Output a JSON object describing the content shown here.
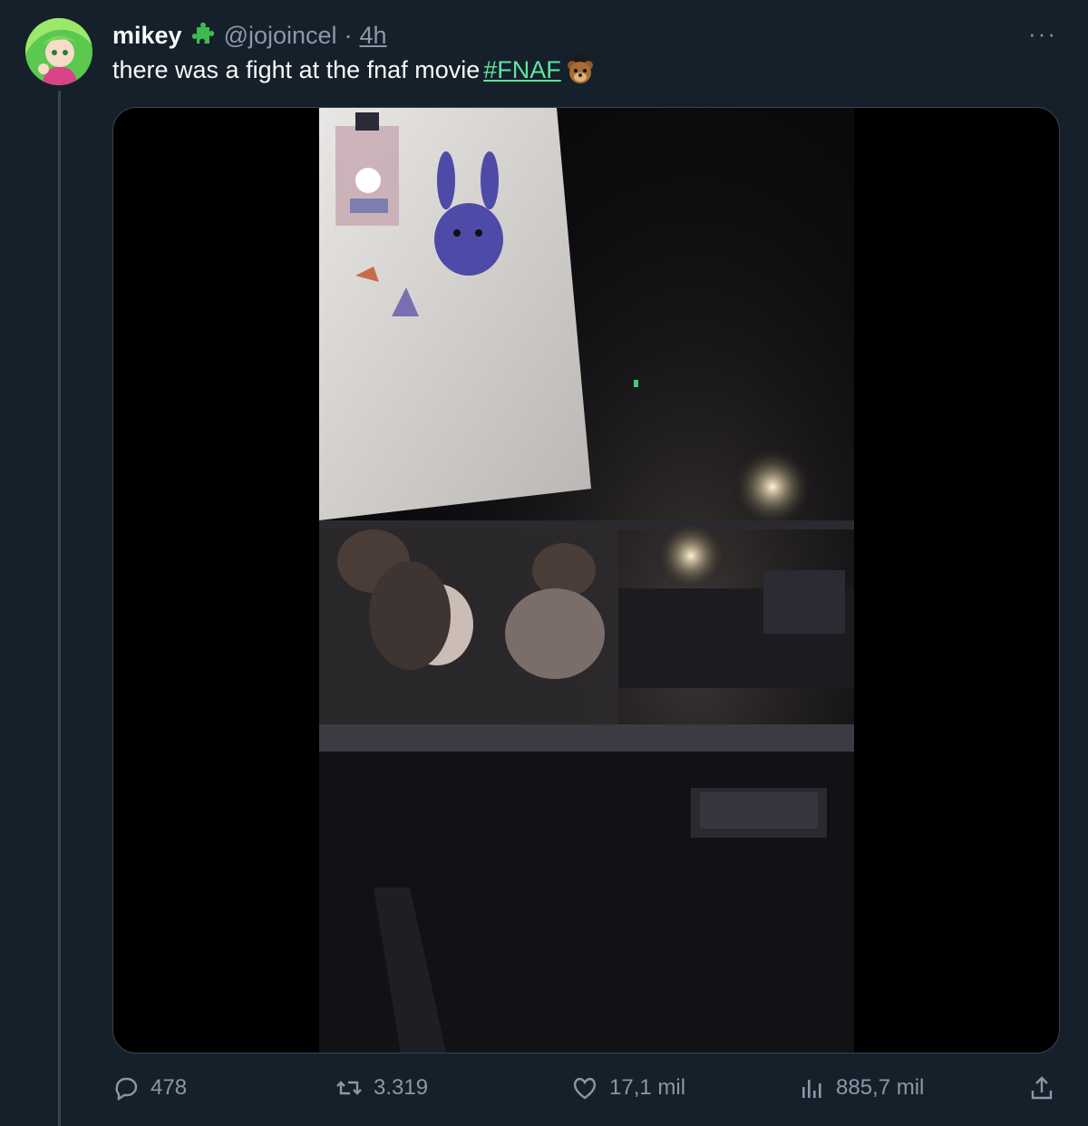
{
  "tweet": {
    "author_name": "mikey",
    "author_handle": "@jojoincel",
    "separator": "·",
    "timestamp": "4h",
    "text": "there was a fight at the fnaf movie",
    "hashtag": "#FNAF",
    "more_label": "···"
  },
  "actions": {
    "replies": "478",
    "reposts": "3.319",
    "likes": "17,1 mil",
    "views": "885,7 mil"
  },
  "icons": {
    "badge": "green-puzzle-piece-icon",
    "hashtag_emoji": "bear-face-icon",
    "reply": "speech-bubble-icon",
    "repost": "repost-arrows-icon",
    "like": "heart-icon",
    "views": "bar-chart-icon",
    "share": "share-upload-icon"
  },
  "colors": {
    "background": "#15202b",
    "hashtag": "#5ee3a0",
    "muted": "#8b98a5"
  }
}
